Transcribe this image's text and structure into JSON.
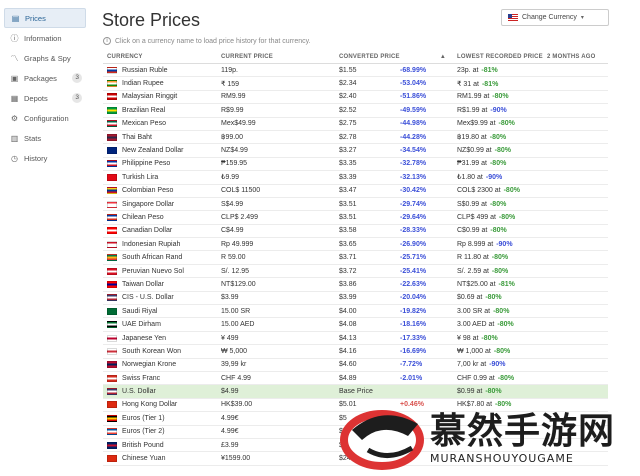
{
  "sidebar": {
    "items": [
      {
        "label": "Prices",
        "icon": "price-list-icon",
        "badge": "",
        "active": true
      },
      {
        "label": "Information",
        "icon": "info-icon",
        "badge": ""
      },
      {
        "label": "Graphs & Spy",
        "icon": "graph-icon",
        "badge": ""
      },
      {
        "label": "Packages",
        "icon": "package-icon",
        "badge": "3"
      },
      {
        "label": "Depots",
        "icon": "depot-icon",
        "badge": "3"
      },
      {
        "label": "Configuration",
        "icon": "config-icon",
        "badge": ""
      },
      {
        "label": "Stats",
        "icon": "stats-icon",
        "badge": ""
      },
      {
        "label": "History",
        "icon": "history-icon",
        "badge": ""
      }
    ]
  },
  "header": {
    "title": "Store Prices",
    "subtitle": "Click on a currency name to load price history for that currency.",
    "currency_button": "Change Currency"
  },
  "table": {
    "columns": [
      "CURRENCY",
      "CURRENT PRICE",
      "CONVERTED PRICE",
      "",
      "LOWEST RECORDED PRICE",
      "2 MONTHS AGO"
    ],
    "rows": [
      {
        "name": "Russian Ruble",
        "flag": [
          "#fff",
          "#0039a6",
          "#d52b1e"
        ],
        "price": "119p.",
        "converted": "$1.55",
        "diff": "-68.99%",
        "sign": "neg",
        "lowest": "23p. at",
        "lowest_pct": "-81%",
        "lp_color": "green"
      },
      {
        "name": "Indian Rupee",
        "flag": [
          "#ff9933",
          "#fff",
          "#138808"
        ],
        "price": "₹ 159",
        "converted": "$2.34",
        "diff": "-53.04%",
        "sign": "neg",
        "lowest": "₹ 31 at",
        "lowest_pct": "-81%",
        "lp_color": "green"
      },
      {
        "name": "Malaysian Ringgit",
        "flag": [
          "#cc0001",
          "#fff",
          "#cc0001"
        ],
        "price": "RM9.99",
        "converted": "$2.40",
        "diff": "-51.86%",
        "sign": "neg",
        "lowest": "RM1.99 at",
        "lowest_pct": "-80%",
        "lp_color": "green"
      },
      {
        "name": "Brazilian Real",
        "flag": [
          "#009c3b",
          "#ffdf00",
          "#009c3b"
        ],
        "price": "R$9.99",
        "converted": "$2.52",
        "diff": "-49.59%",
        "sign": "neg",
        "lowest": "R$1.99 at",
        "lowest_pct": "-90%",
        "lp_color": "blue"
      },
      {
        "name": "Mexican Peso",
        "flag": [
          "#006847",
          "#fff",
          "#ce1126"
        ],
        "price": "Mex$49.99",
        "converted": "$2.75",
        "diff": "-44.98%",
        "sign": "neg",
        "lowest": "Mex$9.99 at",
        "lowest_pct": "-80%",
        "lp_color": "green"
      },
      {
        "name": "Thai Baht",
        "flag": [
          "#a51931",
          "#2d2a4a",
          "#a51931"
        ],
        "price": "฿99.00",
        "converted": "$2.78",
        "diff": "-44.28%",
        "sign": "neg",
        "lowest": "฿19.80 at",
        "lowest_pct": "-80%",
        "lp_color": "green"
      },
      {
        "name": "New Zealand Dollar",
        "flag": [
          "#00247d",
          "#00247d",
          "#00247d"
        ],
        "price": "NZ$4.99",
        "converted": "$3.27",
        "diff": "-34.54%",
        "sign": "neg",
        "lowest": "NZ$0.99 at",
        "lowest_pct": "-80%",
        "lp_color": "green"
      },
      {
        "name": "Philippine Peso",
        "flag": [
          "#0038a8",
          "#fff",
          "#ce1126"
        ],
        "price": "₱159.95",
        "converted": "$3.35",
        "diff": "-32.78%",
        "sign": "neg",
        "lowest": "₱31.99 at",
        "lowest_pct": "-80%",
        "lp_color": "green"
      },
      {
        "name": "Turkish Lira",
        "flag": [
          "#e30a17",
          "#e30a17",
          "#e30a17"
        ],
        "price": "₺9.99",
        "converted": "$3.39",
        "diff": "-32.13%",
        "sign": "neg",
        "lowest": "₺1.80 at",
        "lowest_pct": "-90%",
        "lp_color": "blue"
      },
      {
        "name": "Colombian Peso",
        "flag": [
          "#fcd116",
          "#003893",
          "#ce1126"
        ],
        "price": "COL$ 11500",
        "converted": "$3.47",
        "diff": "-30.42%",
        "sign": "neg",
        "lowest": "COL$ 2300 at",
        "lowest_pct": "-80%",
        "lp_color": "green"
      },
      {
        "name": "Singapore Dollar",
        "flag": [
          "#ef3340",
          "#fff",
          "#fff"
        ],
        "price": "S$4.99",
        "converted": "$3.51",
        "diff": "-29.74%",
        "sign": "neg",
        "lowest": "S$0.99 at",
        "lowest_pct": "-80%",
        "lp_color": "green"
      },
      {
        "name": "Chilean Peso",
        "flag": [
          "#0039a6",
          "#fff",
          "#d52b1e"
        ],
        "price": "CLP$ 2.499",
        "converted": "$3.51",
        "diff": "-29.64%",
        "sign": "neg",
        "lowest": "CLP$ 499 at",
        "lowest_pct": "-80%",
        "lp_color": "green"
      },
      {
        "name": "Canadian Dollar",
        "flag": [
          "#ff0000",
          "#fff",
          "#ff0000"
        ],
        "price": "C$4.99",
        "converted": "$3.58",
        "diff": "-28.33%",
        "sign": "neg",
        "lowest": "C$0.99 at",
        "lowest_pct": "-80%",
        "lp_color": "green"
      },
      {
        "name": "Indonesian Rupiah",
        "flag": [
          "#ce1126",
          "#fff",
          "#fff"
        ],
        "price": "Rp 49.999",
        "converted": "$3.65",
        "diff": "-26.90%",
        "sign": "neg",
        "lowest": "Rp 8.999 at",
        "lowest_pct": "-90%",
        "lp_color": "blue"
      },
      {
        "name": "South African Rand",
        "flag": [
          "#007a4d",
          "#ffb612",
          "#de3831"
        ],
        "price": "R 59.00",
        "converted": "$3.71",
        "diff": "-25.71%",
        "sign": "neg",
        "lowest": "R 11.80 at",
        "lowest_pct": "-80%",
        "lp_color": "green"
      },
      {
        "name": "Peruvian Nuevo Sol",
        "flag": [
          "#d91023",
          "#fff",
          "#d91023"
        ],
        "price": "S/. 12.95",
        "converted": "$3.72",
        "diff": "-25.41%",
        "sign": "neg",
        "lowest": "S/. 2.59 at",
        "lowest_pct": "-80%",
        "lp_color": "green"
      },
      {
        "name": "Taiwan Dollar",
        "flag": [
          "#fe0000",
          "#000095",
          "#fe0000"
        ],
        "price": "NT$129.00",
        "converted": "$3.86",
        "diff": "-22.63%",
        "sign": "neg",
        "lowest": "NT$25.00 at",
        "lowest_pct": "-81%",
        "lp_color": "green"
      },
      {
        "name": "CIS - U.S. Dollar",
        "flag": [
          "#3c3b6e",
          "#fff",
          "#b22234"
        ],
        "price": "$3.99",
        "converted": "$3.99",
        "diff": "-20.04%",
        "sign": "neg",
        "lowest": "$0.69 at",
        "lowest_pct": "-80%",
        "lp_color": "green"
      },
      {
        "name": "Saudi Riyal",
        "flag": [
          "#006c35",
          "#006c35",
          "#006c35"
        ],
        "price": "15.00 SR",
        "converted": "$4.00",
        "diff": "-19.82%",
        "sign": "neg",
        "lowest": "3.00 SR at",
        "lowest_pct": "-80%",
        "lp_color": "green"
      },
      {
        "name": "UAE Dirham",
        "flag": [
          "#00732f",
          "#fff",
          "#000"
        ],
        "price": "15.00 AED",
        "converted": "$4.08",
        "diff": "-18.16%",
        "sign": "neg",
        "lowest": "3.00 AED at",
        "lowest_pct": "-80%",
        "lp_color": "green"
      },
      {
        "name": "Japanese Yen",
        "flag": [
          "#fff",
          "#bc002d",
          "#fff"
        ],
        "price": "¥ 499",
        "converted": "$4.13",
        "diff": "-17.33%",
        "sign": "neg",
        "lowest": "¥ 98 at",
        "lowest_pct": "-80%",
        "lp_color": "green"
      },
      {
        "name": "South Korean Won",
        "flag": [
          "#fff",
          "#cd2e3a",
          "#fff"
        ],
        "price": "₩ 5,000",
        "converted": "$4.16",
        "diff": "-16.69%",
        "sign": "neg",
        "lowest": "₩ 1,000 at",
        "lowest_pct": "-80%",
        "lp_color": "green"
      },
      {
        "name": "Norwegian Krone",
        "flag": [
          "#ba0c2f",
          "#00205b",
          "#ba0c2f"
        ],
        "price": "39,99 kr",
        "converted": "$4.60",
        "diff": "-7.72%",
        "sign": "neg",
        "lowest": "7,00 kr at",
        "lowest_pct": "-90%",
        "lp_color": "blue"
      },
      {
        "name": "Swiss Franc",
        "flag": [
          "#d52b1e",
          "#fff",
          "#d52b1e"
        ],
        "price": "CHF 4.99",
        "converted": "$4.89",
        "diff": "-2.01%",
        "sign": "neg",
        "lowest": "CHF 0.99 at",
        "lowest_pct": "-80%",
        "lp_color": "green"
      },
      {
        "name": "U.S. Dollar",
        "flag": [
          "#3c3b6e",
          "#fff",
          "#b22234"
        ],
        "price": "$4.99",
        "converted": "Base Price",
        "diff": "",
        "sign": "base",
        "lowest": "$0.99 at",
        "lowest_pct": "-80%",
        "lp_color": "green",
        "base": true
      },
      {
        "name": "Hong Kong Dollar",
        "flag": [
          "#de2910",
          "#de2910",
          "#de2910"
        ],
        "price": "HK$39.00",
        "converted": "$5.01",
        "diff": "+0.46%",
        "sign": "pos",
        "lowest": "HK$7.80 at",
        "lowest_pct": "-80%",
        "lp_color": "green"
      },
      {
        "name": "Euros (Tier 1)",
        "flag": [
          "#000",
          "#ffce00",
          "#dd0000"
        ],
        "price": "4.99€",
        "converted": "$5",
        "diff": "",
        "sign": "pos",
        "lowest": "",
        "lowest_pct": "",
        "lp_color": "green"
      },
      {
        "name": "Euros (Tier 2)",
        "flag": [
          "#0055a4",
          "#fff",
          "#ef4135"
        ],
        "price": "4.99€",
        "converted": "$5",
        "diff": "",
        "sign": "pos",
        "lowest": "",
        "lowest_pct": "",
        "lp_color": "green"
      },
      {
        "name": "British Pound",
        "flag": [
          "#012169",
          "#c8102e",
          "#012169"
        ],
        "price": "£3.99",
        "converted": "$5",
        "diff": "",
        "sign": "pos",
        "lowest": "",
        "lowest_pct": "",
        "lp_color": "green"
      },
      {
        "name": "Chinese Yuan",
        "flag": [
          "#de2910",
          "#de2910",
          "#de2910"
        ],
        "price": "¥1599.00",
        "converted": "$243",
        "diff": "",
        "sign": "pos",
        "lowest": "",
        "lowest_pct": "",
        "lp_color": "green"
      }
    ]
  },
  "watermark": {
    "text": "慕然手游网",
    "sub": "MURANSHOUYOUGAME"
  }
}
